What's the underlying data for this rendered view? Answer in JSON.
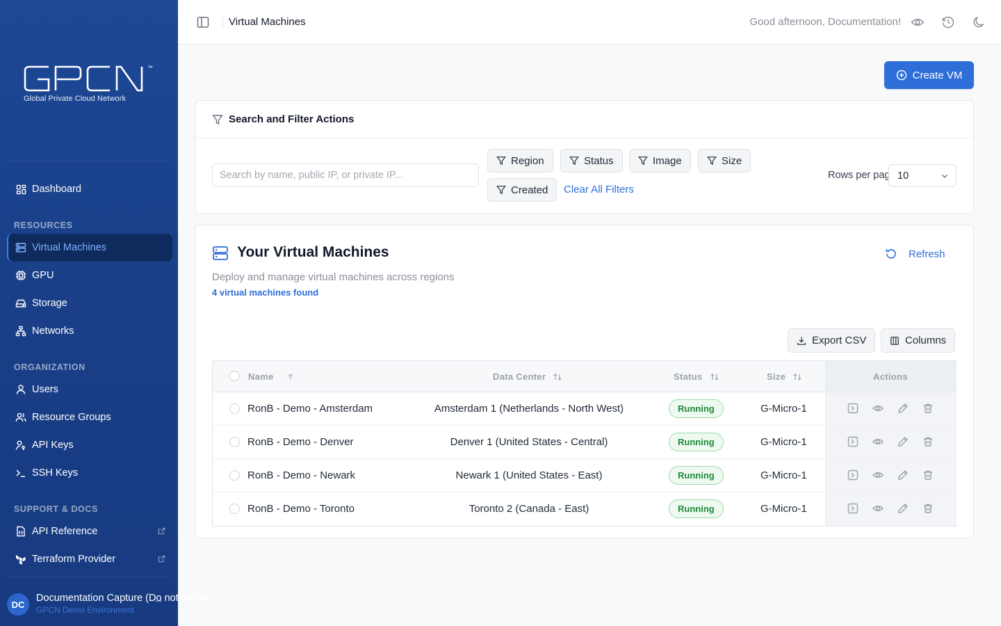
{
  "brand": {
    "logo_text": "GPCN",
    "tm": "™",
    "subtitle": "Global Private Cloud Network"
  },
  "sidebar": {
    "dashboard": "Dashboard",
    "resources_label": "RESOURCES",
    "resources": [
      {
        "label": "Virtual Machines",
        "icon": "server-icon",
        "active": true
      },
      {
        "label": "GPU",
        "icon": "chip-icon"
      },
      {
        "label": "Storage",
        "icon": "storage-icon"
      },
      {
        "label": "Networks",
        "icon": "network-icon"
      }
    ],
    "organization_label": "ORGANIZATION",
    "organization": [
      {
        "label": "Users",
        "icon": "user-icon"
      },
      {
        "label": "Resource Groups",
        "icon": "users-icon"
      },
      {
        "label": "API Keys",
        "icon": "user-key-icon"
      },
      {
        "label": "SSH Keys",
        "icon": "terminal-icon"
      }
    ],
    "support_label": "SUPPORT & DOCS",
    "support": [
      {
        "label": "API Reference",
        "icon": "doc-code-icon"
      },
      {
        "label": "Terraform Provider",
        "icon": "terraform-icon"
      }
    ],
    "user": {
      "initials": "DC",
      "name": "Documentation Capture (Do not delete)",
      "env": "GPCN Demo Environment",
      "more": "..."
    }
  },
  "topbar": {
    "title": "Virtual Machines",
    "greeting": "Good afternoon, Documentation!"
  },
  "create_button": "Create VM",
  "filters": {
    "title": "Search and Filter Actions",
    "search_placeholder": "Search by name, public IP, or private IP...",
    "chips": [
      "Region",
      "Status",
      "Image",
      "Size",
      "Created"
    ],
    "clear": "Clear All Filters",
    "rows_label": "Rows per page:",
    "rows_value": "10"
  },
  "vm_list": {
    "title": "Your Virtual Machines",
    "description": "Deploy and manage virtual machines across regions",
    "count": "4 virtual machines found",
    "refresh": "Refresh",
    "export": "Export CSV",
    "columns": "Columns",
    "headers": {
      "name": "Name",
      "data_center": "Data Center",
      "status": "Status",
      "size": "Size",
      "actions": "Actions"
    },
    "rows": [
      {
        "name": "RonB - Demo - Amsterdam",
        "data_center": "Amsterdam 1 (Netherlands - North West)",
        "status": "Running",
        "size": "G-Micro-1"
      },
      {
        "name": "RonB - Demo - Denver",
        "data_center": "Denver 1 (United States - Central)",
        "status": "Running",
        "size": "G-Micro-1"
      },
      {
        "name": "RonB - Demo - Newark",
        "data_center": "Newark 1 (United States - East)",
        "status": "Running",
        "size": "G-Micro-1"
      },
      {
        "name": "RonB - Demo - Toronto",
        "data_center": "Toronto 2 (Canada - East)",
        "status": "Running",
        "size": "G-Micro-1"
      }
    ]
  },
  "colors": {
    "sidebar": "#1d4896",
    "accent": "#2e6ed8",
    "active_nav": "#0f2a5c",
    "running": "#1f8a3a"
  }
}
